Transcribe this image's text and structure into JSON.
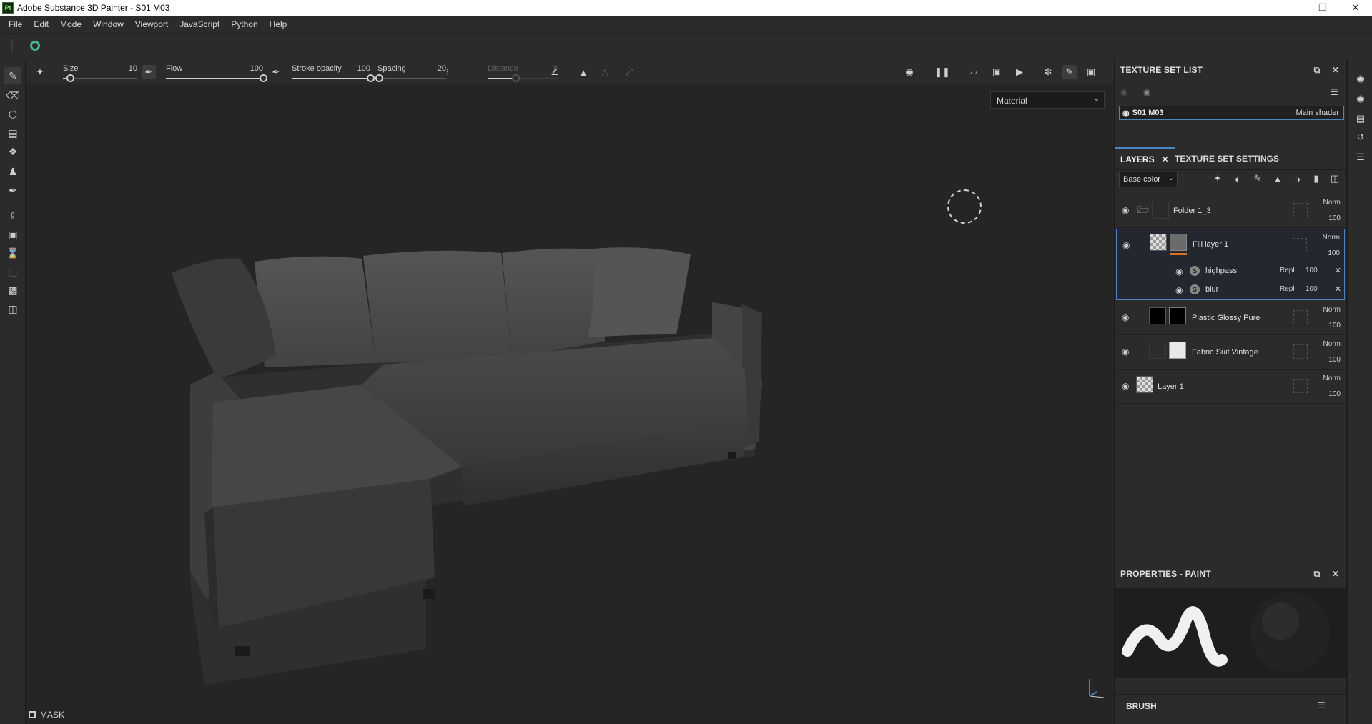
{
  "window": {
    "title": "Adobe Substance 3D Painter - S01 M03",
    "app_icon": "Pt"
  },
  "menu": [
    "File",
    "Edit",
    "Mode",
    "Window",
    "Viewport",
    "JavaScript",
    "Python",
    "Help"
  ],
  "context_toolbar": {
    "size": {
      "label": "Size",
      "value": "10",
      "level": 0.1
    },
    "flow": {
      "label": "Flow",
      "value": "100",
      "level": 1.0
    },
    "stroke_opacity": {
      "label": "Stroke opacity",
      "value": "100",
      "level": 1.0
    },
    "spacing": {
      "label": "Spacing",
      "value": "20",
      "level": 0.02
    },
    "distance": {
      "label": "Distance",
      "value": "8",
      "level": 0.4
    }
  },
  "viewport": {
    "mode_select": "Material",
    "mask_label": "MASK"
  },
  "texture_set_list": {
    "title": "TEXTURE SET LIST",
    "item": {
      "name": "S01 M03",
      "shader": "Main shader"
    }
  },
  "layers_panel": {
    "tabs": [
      "LAYERS",
      "TEXTURE SET SETTINGS"
    ],
    "channel": "Base color",
    "layers": [
      {
        "name": "Folder 1_3",
        "blend": "Norm",
        "opacity": "100"
      },
      {
        "name": "Fill layer 1",
        "blend": "Norm",
        "opacity": "100"
      },
      {
        "name": "Plastic Glossy Pure",
        "blend": "Norm",
        "opacity": "100"
      },
      {
        "name": "Fabric Suit Vintage",
        "blend": "Norm",
        "opacity": "100"
      },
      {
        "name": "Layer 1",
        "blend": "Norm",
        "opacity": "100"
      }
    ],
    "effects": [
      {
        "name": "highpass",
        "blend": "Repl",
        "opacity": "100"
      },
      {
        "name": "blur",
        "blend": "Repl",
        "opacity": "100"
      }
    ]
  },
  "properties": {
    "title": "PROPERTIES - PAINT",
    "brush_label": "BRUSH"
  },
  "colors": {
    "accent": "#4a84c4",
    "panel": "#2b2b2b",
    "viewport": "#252525",
    "fill_marker": "#e07020"
  }
}
